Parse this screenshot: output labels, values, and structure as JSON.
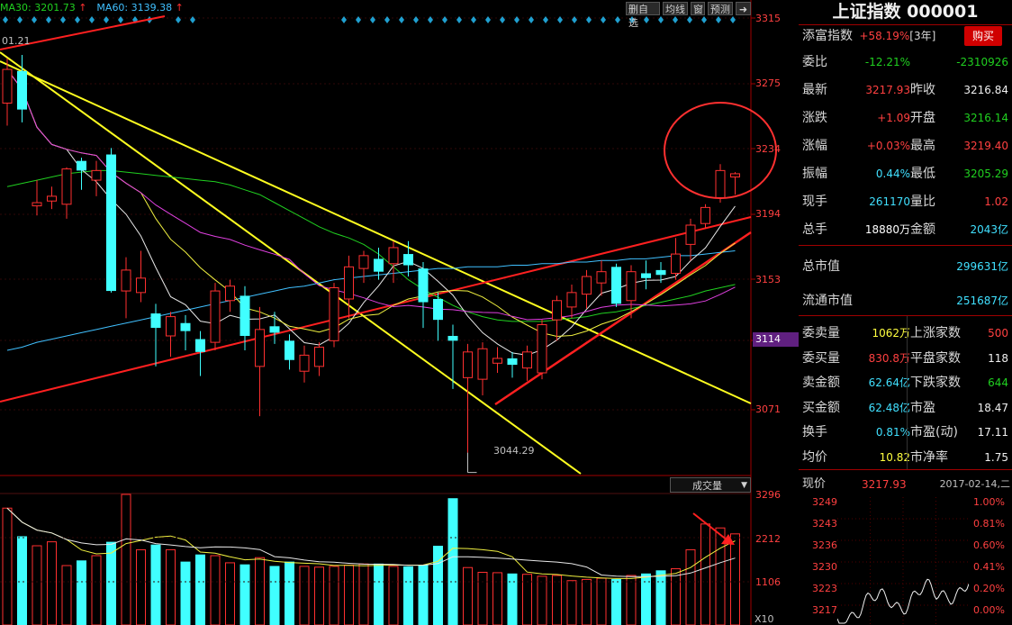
{
  "header": {
    "ma_items": [
      {
        "text": "MA30: 3201.73",
        "color": "#20d020"
      },
      {
        "text": "MA60: 3139.38",
        "color": "#40c0ff"
      }
    ],
    "top_left_label": "01.21",
    "buttons": [
      "删自选",
      "均线",
      "窗",
      "预测"
    ],
    "exit_icon": "exit-icon"
  },
  "price_axis": {
    "ticks": [
      "3315",
      "3275",
      "3234",
      "3194",
      "3153",
      "3114",
      "3071"
    ],
    "highlight": "3114",
    "highlight_color": "#602080"
  },
  "annotation_low": "3044.29",
  "volume": {
    "dropdown_label": "成交量",
    "ticks": [
      "3296",
      "2212",
      "1106"
    ],
    "unit_label": "X10"
  },
  "chart_data": {
    "type": "candlestick",
    "price_ylim": [
      3030,
      3316
    ],
    "candles": [
      {
        "o": 3262,
        "c": 3283,
        "h": 3290,
        "l": 3248
      },
      {
        "o": 3282,
        "c": 3258,
        "h": 3292,
        "l": 3250
      },
      {
        "o": 3198,
        "c": 3200,
        "h": 3214,
        "l": 3192
      },
      {
        "o": 3201,
        "c": 3204,
        "h": 3210,
        "l": 3196
      },
      {
        "o": 3199,
        "c": 3221,
        "h": 3222,
        "l": 3190
      },
      {
        "o": 3226,
        "c": 3220,
        "h": 3228,
        "l": 3208
      },
      {
        "o": 3214,
        "c": 3220,
        "h": 3226,
        "l": 3204
      },
      {
        "o": 3230,
        "c": 3145,
        "h": 3234,
        "l": 3144
      },
      {
        "o": 3145,
        "c": 3158,
        "h": 3166,
        "l": 3128
      },
      {
        "o": 3144,
        "c": 3153,
        "h": 3170,
        "l": 3138
      },
      {
        "o": 3131,
        "c": 3122,
        "h": 3137,
        "l": 3098
      },
      {
        "o": 3117,
        "c": 3129,
        "h": 3132,
        "l": 3104
      },
      {
        "o": 3125,
        "c": 3120,
        "h": 3130,
        "l": 3108
      },
      {
        "o": 3115,
        "c": 3107,
        "h": 3120,
        "l": 3092
      },
      {
        "o": 3113,
        "c": 3145,
        "h": 3150,
        "l": 3108
      },
      {
        "o": 3139,
        "c": 3148,
        "h": 3152,
        "l": 3132
      },
      {
        "o": 3142,
        "c": 3117,
        "h": 3148,
        "l": 3108
      },
      {
        "o": 3098,
        "c": 3121,
        "h": 3135,
        "l": 3067
      },
      {
        "o": 3123,
        "c": 3119,
        "h": 3132,
        "l": 3112
      },
      {
        "o": 3114,
        "c": 3102,
        "h": 3118,
        "l": 3096
      },
      {
        "o": 3095,
        "c": 3105,
        "h": 3111,
        "l": 3088
      },
      {
        "o": 3098,
        "c": 3110,
        "h": 3113,
        "l": 3092
      },
      {
        "o": 3114,
        "c": 3147,
        "h": 3150,
        "l": 3110
      },
      {
        "o": 3140,
        "c": 3160,
        "h": 3167,
        "l": 3128
      },
      {
        "o": 3159,
        "c": 3167,
        "h": 3170,
        "l": 3150
      },
      {
        "o": 3165,
        "c": 3157,
        "h": 3172,
        "l": 3152
      },
      {
        "o": 3162,
        "c": 3172,
        "h": 3176,
        "l": 3150
      },
      {
        "o": 3168,
        "c": 3161,
        "h": 3176,
        "l": 3154
      },
      {
        "o": 3159,
        "c": 3138,
        "h": 3163,
        "l": 3122
      },
      {
        "o": 3140,
        "c": 3127,
        "h": 3144,
        "l": 3114
      },
      {
        "o": 3117,
        "c": 3114,
        "h": 3124,
        "l": 3084
      },
      {
        "o": 3091,
        "c": 3107,
        "h": 3112,
        "l": 3044.29
      },
      {
        "o": 3090,
        "c": 3109,
        "h": 3113,
        "l": 3080
      },
      {
        "o": 3100,
        "c": 3103,
        "h": 3110,
        "l": 3094
      },
      {
        "o": 3103,
        "c": 3099,
        "h": 3107,
        "l": 3091
      },
      {
        "o": 3097,
        "c": 3107,
        "h": 3111,
        "l": 3089
      },
      {
        "o": 3094,
        "c": 3124,
        "h": 3127,
        "l": 3090
      },
      {
        "o": 3127,
        "c": 3139,
        "h": 3142,
        "l": 3114
      },
      {
        "o": 3135,
        "c": 3144,
        "h": 3149,
        "l": 3128
      },
      {
        "o": 3143,
        "c": 3154,
        "h": 3158,
        "l": 3134
      },
      {
        "o": 3150,
        "c": 3157,
        "h": 3164,
        "l": 3142
      },
      {
        "o": 3160,
        "c": 3137,
        "h": 3162,
        "l": 3135
      },
      {
        "o": 3139,
        "c": 3157,
        "h": 3161,
        "l": 3128
      },
      {
        "o": 3156,
        "c": 3153,
        "h": 3164,
        "l": 3146
      },
      {
        "o": 3158,
        "c": 3155,
        "h": 3163,
        "l": 3150
      },
      {
        "o": 3156,
        "c": 3168,
        "h": 3178,
        "l": 3152
      },
      {
        "o": 3174,
        "c": 3186,
        "h": 3190,
        "l": 3164
      },
      {
        "o": 3187,
        "c": 3197,
        "h": 3199,
        "l": 3184
      },
      {
        "o": 3203,
        "c": 3220,
        "h": 3224,
        "l": 3200
      },
      {
        "o": 3216,
        "c": 3218,
        "h": 3219,
        "l": 3205
      }
    ],
    "volumes": [
      2950,
      2240,
      2000,
      2100,
      1500,
      1630,
      1750,
      2100,
      3296,
      1900,
      2030,
      1900,
      1600,
      1780,
      1750,
      1570,
      1530,
      1700,
      1490,
      1600,
      1480,
      1460,
      1480,
      1510,
      1540,
      1550,
      1480,
      1480,
      1520,
      2000,
      3200,
      1450,
      1330,
      1320,
      1300,
      1280,
      1230,
      1250,
      1120,
      1150,
      1180,
      1160,
      1250,
      1300,
      1380,
      1420,
      1900,
      2550,
      2450,
      2300
    ],
    "ma_lines": [
      {
        "name": "MA30",
        "color": "#20d020",
        "values": [
          3210,
          3212,
          3214,
          3216,
          3218,
          3219,
          3220,
          3220,
          3219,
          3218,
          3217,
          3216,
          3215,
          3214,
          3213,
          3211,
          3208,
          3205,
          3200,
          3195,
          3190,
          3185,
          3181,
          3178,
          3174,
          3168,
          3160,
          3152,
          3146,
          3141,
          3136,
          3132,
          3129,
          3127,
          3126,
          3126,
          3126,
          3127,
          3128,
          3129,
          3131,
          3132,
          3134,
          3136,
          3138,
          3140,
          3142,
          3145,
          3147,
          3149
        ]
      },
      {
        "name": "MA60",
        "color": "#40c0ff",
        "values": [
          3108,
          3110,
          3113,
          3115,
          3117,
          3119,
          3121,
          3123,
          3125,
          3127,
          3129,
          3131,
          3133,
          3135,
          3137,
          3139,
          3141,
          3143,
          3145,
          3147,
          3148,
          3150,
          3152,
          3153,
          3154,
          3155,
          3156,
          3157,
          3158,
          3159,
          3159,
          3160,
          3160,
          3160,
          3161,
          3161,
          3162,
          3162,
          3163,
          3163,
          3164,
          3164,
          3165,
          3165,
          3166,
          3167,
          3167,
          3168,
          3169,
          3170
        ]
      }
    ]
  },
  "right_panel": {
    "title": "上证指数 000001",
    "rows": [
      {
        "l1": "添富指数",
        "v1": "+58.19%",
        "l2": "[3年]",
        "v2": "",
        "btn": "购买"
      },
      {
        "l1": "委比",
        "v1": "-12.21%",
        "l2": "",
        "v2": "-2310926"
      },
      {
        "l1": "最新",
        "v1": "3217.93",
        "l2": "昨收",
        "v2": "3216.84"
      },
      {
        "l1": "涨跌",
        "v1": "+1.09",
        "l2": "开盘",
        "v2": "3216.14"
      },
      {
        "l1": "涨幅",
        "v1": "+0.03%",
        "l2": "最高",
        "v2": "3219.40"
      },
      {
        "l1": "振幅",
        "v1": "0.44%",
        "l2": "最低",
        "v2": "3205.29"
      },
      {
        "l1": "现手",
        "v1": "261170",
        "l2": "量比",
        "v2": "1.02"
      },
      {
        "l1": "总手",
        "v1": "18880万",
        "l2": "金额",
        "v2": "2043亿"
      }
    ],
    "market": [
      {
        "label": "总市值",
        "value": "299631亿"
      },
      {
        "label": "流通市值",
        "value": "251687亿"
      }
    ],
    "stats": [
      {
        "l1": "委卖量",
        "v1": "1062万",
        "l2": "上涨家数",
        "v2": "500"
      },
      {
        "l1": "委买量",
        "v1": "830.8万",
        "l2": "平盘家数",
        "v2": "118"
      },
      {
        "l1": "卖金额",
        "v1": "62.64亿",
        "l2": "下跌家数",
        "v2": "644"
      },
      {
        "l1": "买金额",
        "v1": "62.48亿",
        "l2": "市盈",
        "v2": "18.47"
      },
      {
        "l1": "换手",
        "v1": "0.81%",
        "l2": "市盈(动)",
        "v2": "17.11"
      },
      {
        "l1": "均价",
        "v1": "10.82",
        "l2": "市净率",
        "v2": "1.75"
      }
    ],
    "mini": {
      "label": "现价",
      "price": "3217.93",
      "date": "2017-02-14,二",
      "left_ticks": [
        "3249",
        "3243",
        "3236",
        "3230",
        "3223",
        "3217"
      ],
      "right_ticks": [
        "1.00%",
        "0.81%",
        "0.60%",
        "0.41%",
        "0.20%",
        "0.00%"
      ]
    }
  }
}
